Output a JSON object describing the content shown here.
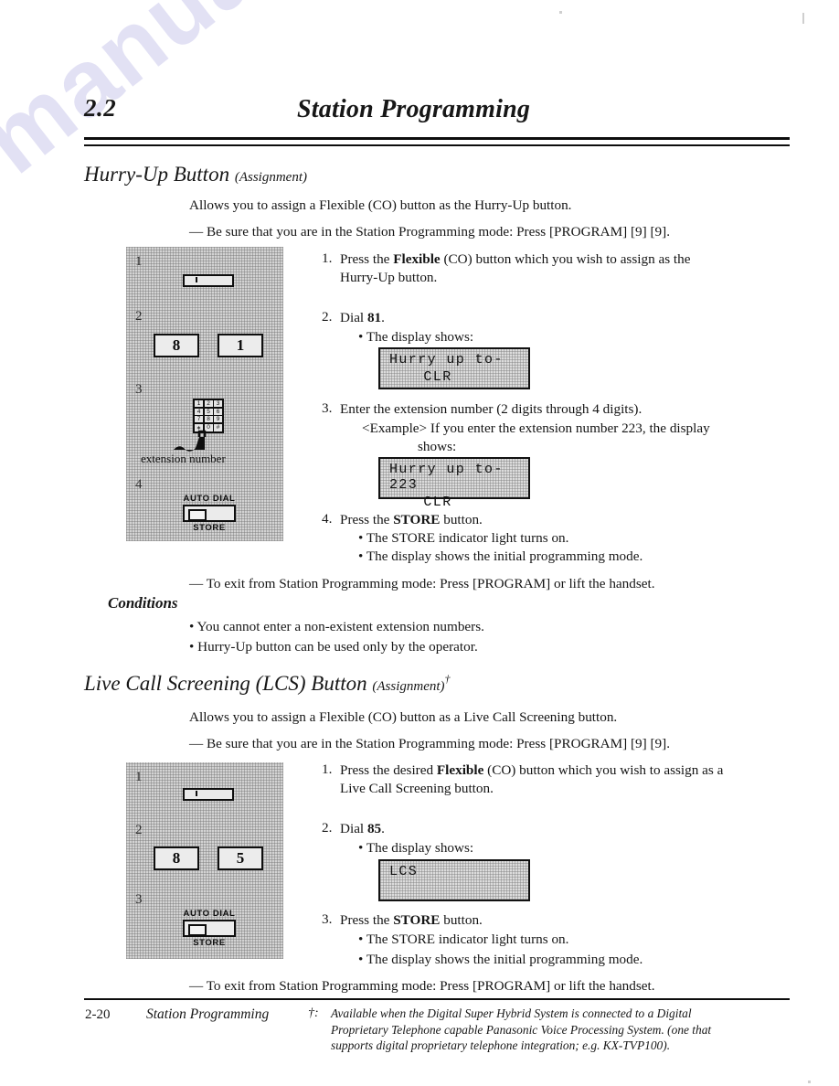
{
  "header": {
    "section_number": "2.2",
    "section_title": "Station Programming"
  },
  "watermark": {
    "text": "manualsarchive.com"
  },
  "sections": [
    {
      "heading": "Hurry-Up Button",
      "heading_suffix": "(Assignment)",
      "intro": "Allows you to assign a Flexible (CO) button as the Hurry-Up button.",
      "precondition": "— Be sure that you are in the Station Programming mode: Press [PROGRAM] [9] [9].",
      "steps": [
        {
          "number": "1.",
          "text_1": "Press the ",
          "bold": "Flexible",
          "text_2": " (CO) button which you wish to assign as the",
          "line2": "Hurry-Up button."
        },
        {
          "number": "2.",
          "text_1": "Dial ",
          "bold": "81",
          "text_2": ".",
          "bullet": "• The display shows:"
        },
        {
          "number": "3.",
          "text_1": "Enter the extension number (2 digits through 4 digits).",
          "example_1": "<Example> If you enter the extension number 223, the display",
          "example_2": "shows:"
        },
        {
          "number": "4.",
          "text_1": "Press the ",
          "bold": "STORE",
          "text_2": " button.",
          "bullet_1": "• The STORE indicator light turns on.",
          "bullet_2": "• The display shows the initial programming mode."
        }
      ],
      "displays": [
        {
          "line1": "Hurry up to-",
          "line2": "CLR"
        },
        {
          "line1": "Hurry up to-223",
          "line2": "CLR"
        }
      ],
      "exit": "— To exit from Station Programming mode: Press [PROGRAM] or lift the handset.",
      "conditions_heading": "Conditions",
      "conditions": [
        "• You cannot enter a non-existent extension numbers.",
        "• Hurry-Up button can be used only by the operator."
      ],
      "diagram": {
        "steps": [
          "1",
          "2",
          "3",
          "4"
        ],
        "keys": [
          "8",
          "1"
        ],
        "keypad_label": "extension number",
        "keypad_keys": [
          "1",
          "2",
          "3",
          "4",
          "5",
          "6",
          "7",
          "8",
          "9",
          "∗",
          "0",
          "#"
        ],
        "store_top_label": "AUTO DIAL",
        "store_bottom_label": "STORE"
      }
    },
    {
      "heading": "Live Call Screening (LCS) Button",
      "heading_suffix": "(Assignment)",
      "heading_dagger": "†",
      "intro": "Allows you to assign a Flexible (CO) button as a Live Call Screening button.",
      "precondition": "— Be sure that you are in the Station Programming mode: Press [PROGRAM] [9] [9].",
      "steps": [
        {
          "number": "1.",
          "text_1": "Press the desired ",
          "bold": "Flexible",
          "text_2": " (CO) button which you wish to assign as a",
          "line2": "Live Call Screening button."
        },
        {
          "number": "2.",
          "text_1": "Dial ",
          "bold": "85",
          "text_2": ".",
          "bullet": "• The display shows:"
        },
        {
          "number": "3.",
          "text_1": "Press the ",
          "bold": "STORE",
          "text_2": " button.",
          "bullet_1": "• The STORE indicator light turns on.",
          "bullet_2": "• The display shows the initial programming mode."
        }
      ],
      "displays": [
        {
          "line1": "LCS",
          "line2": ""
        }
      ],
      "exit": "— To exit from Station Programming mode: Press [PROGRAM] or lift the handset.",
      "diagram": {
        "steps": [
          "1",
          "2",
          "3"
        ],
        "keys": [
          "8",
          "5"
        ],
        "store_top_label": "AUTO DIAL",
        "store_bottom_label": "STORE"
      }
    }
  ],
  "footer": {
    "page_number": "2-20",
    "section_label": "Station Programming",
    "footnote_mark": "†:",
    "footnote_text": "Available when the Digital Super Hybrid System is connected to a Digital Proprietary Telephone capable Panasonic Voice Processing System. (one that supports digital proprietary telephone integration; e.g. KX-TVP100)."
  }
}
